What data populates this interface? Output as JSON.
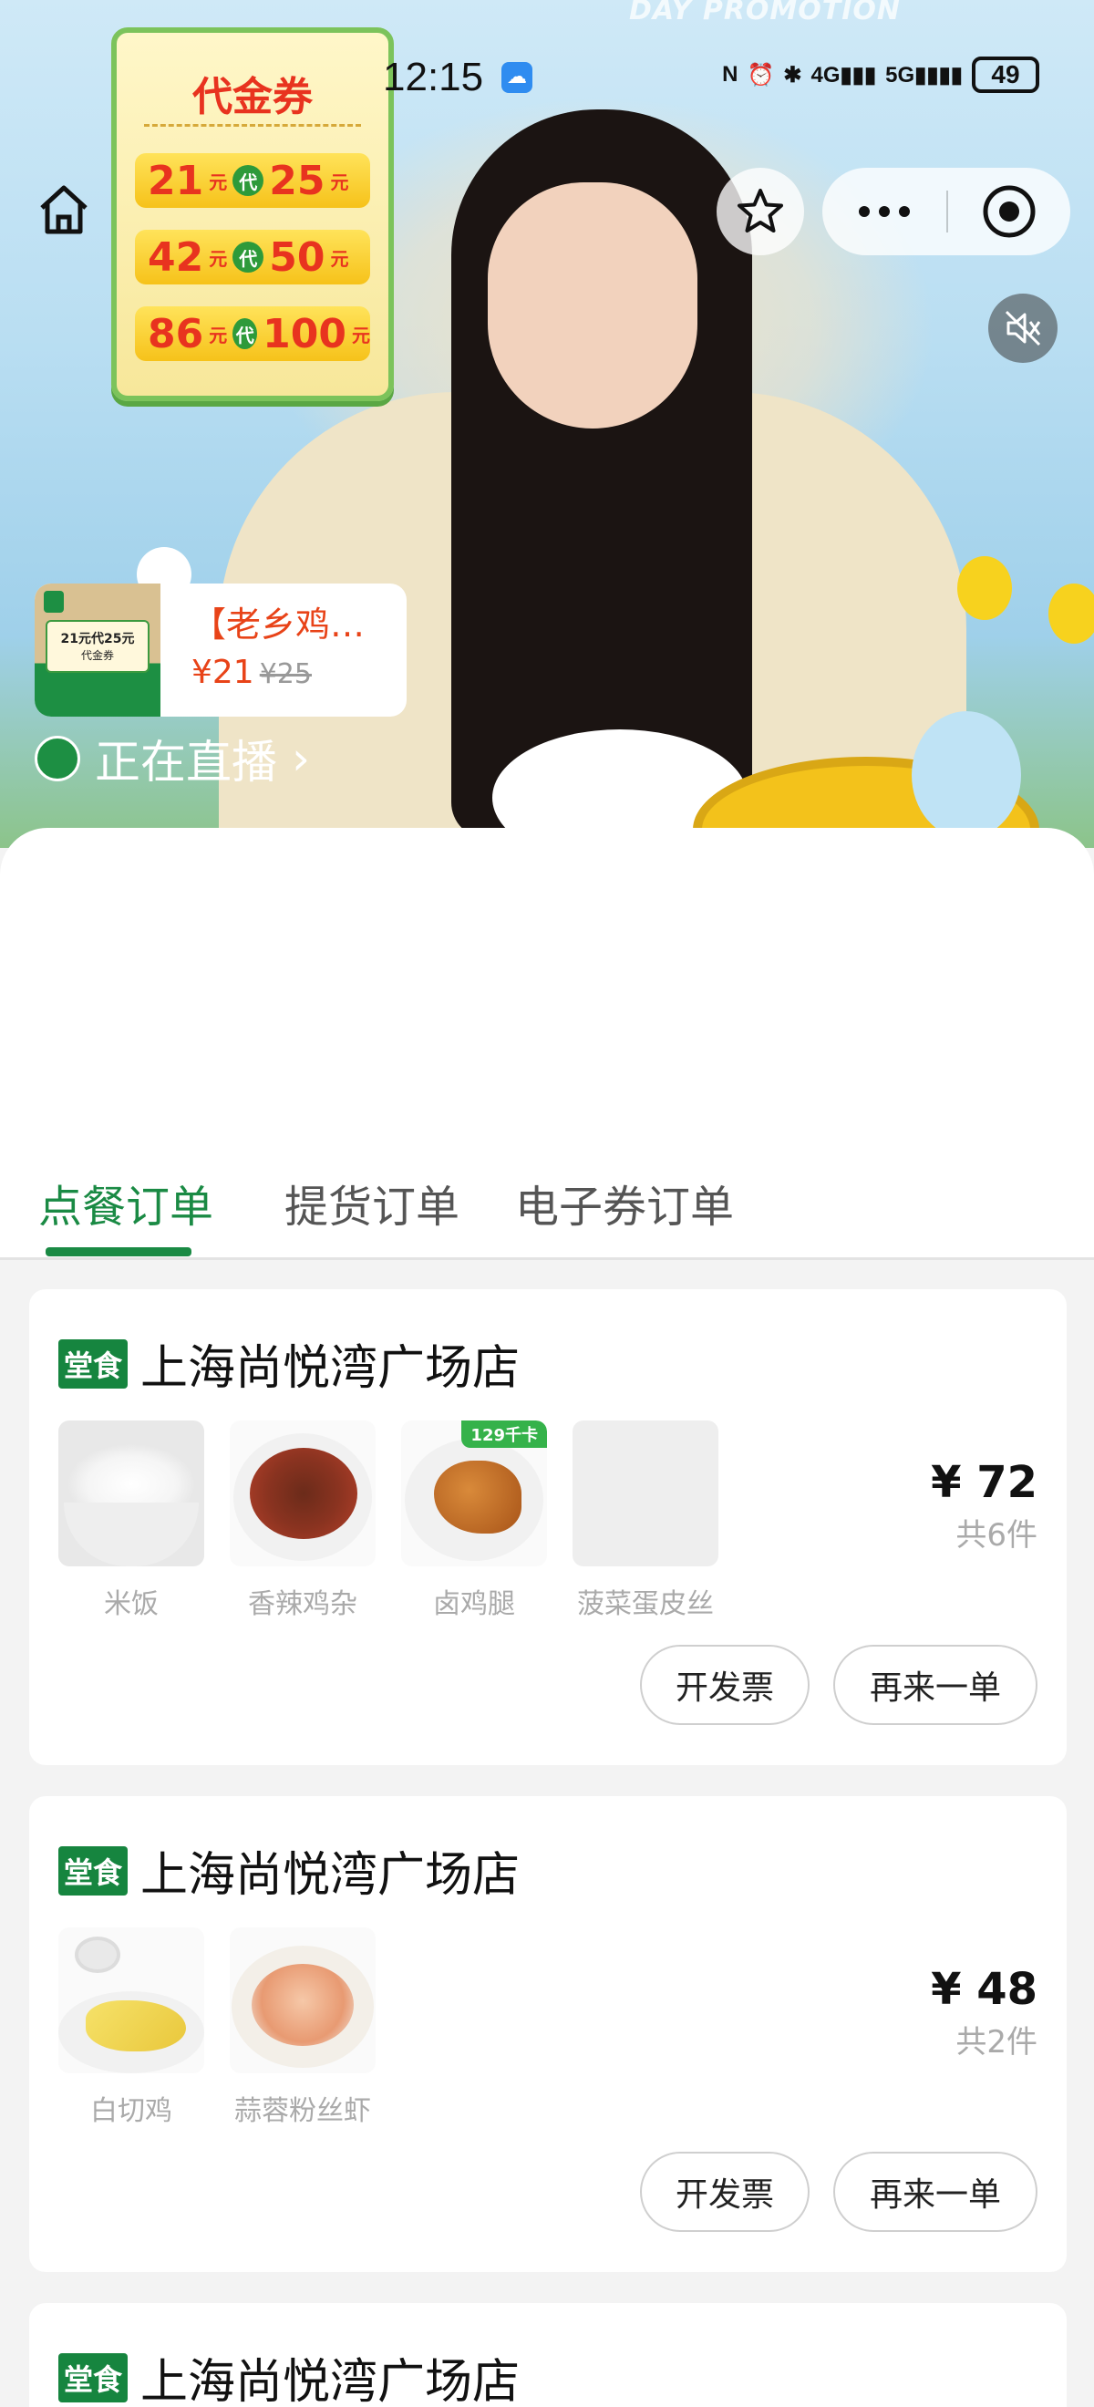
{
  "status_bar": {
    "time": "12:15",
    "battery": "49"
  },
  "live": {
    "promo_banner": "DAY PROMOTION",
    "coupon_board": {
      "title": "代金券",
      "rows": [
        {
          "pay": "21",
          "unit1": "元",
          "dai": "代",
          "get": "25",
          "unit2": "元"
        },
        {
          "pay": "42",
          "unit1": "元",
          "dai": "代",
          "get": "50",
          "unit2": "元"
        },
        {
          "pay": "86",
          "unit1": "元",
          "dai": "代",
          "get": "100",
          "unit2": "元"
        }
      ]
    },
    "product": {
      "thumb_text": "21元代25元",
      "thumb_sub": "代金券",
      "title": "【老乡鸡…",
      "price": "¥21",
      "original_price": "¥25"
    },
    "live_label": "正在直播",
    "live_chevron": "›"
  },
  "tabs": [
    {
      "label": "点餐订单",
      "active": true
    },
    {
      "label": "提货订单",
      "active": false
    },
    {
      "label": "电子券订单",
      "active": false
    }
  ],
  "orders": [
    {
      "tag": "堂食",
      "store": "上海尚悦湾广场店",
      "items": [
        {
          "name": "米饭",
          "icon": "rice-bowl"
        },
        {
          "name": "香辣鸡杂",
          "icon": "spicy-chicken-giblets"
        },
        {
          "name": "卤鸡腿",
          "icon": "braised-chicken-leg",
          "badge": "129千卡"
        },
        {
          "name": "菠菜蛋皮丝",
          "icon": "spinach-egg-placeholder"
        }
      ],
      "price": "¥ 72",
      "count": "共6件",
      "invoice_label": "开发票",
      "reorder_label": "再来一单"
    },
    {
      "tag": "堂食",
      "store": "上海尚悦湾广场店",
      "items": [
        {
          "name": "白切鸡",
          "icon": "white-cut-chicken"
        },
        {
          "name": "蒜蓉粉丝虾",
          "icon": "garlic-vermicelli-shrimp"
        }
      ],
      "price": "¥ 48",
      "count": "共2件",
      "invoice_label": "开发票",
      "reorder_label": "再来一单"
    },
    {
      "tag": "堂食",
      "store": "上海尚悦湾广场店"
    }
  ],
  "colors": {
    "brand_green": "#1a8a44",
    "price_red": "#e84318"
  }
}
